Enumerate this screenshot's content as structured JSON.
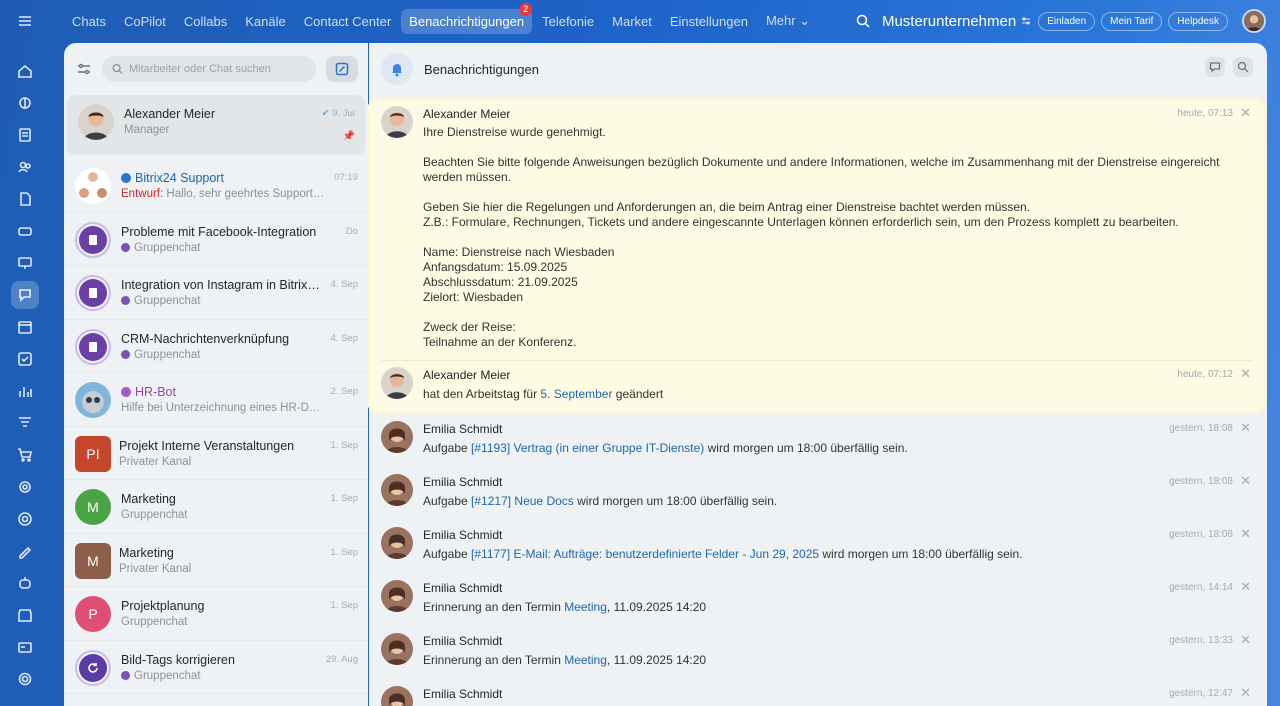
{
  "nav": {
    "items": [
      "Chats",
      "CoPilot",
      "Collabs",
      "Kanäle",
      "Contact Center",
      "Benachrichtigungen",
      "Telefonie",
      "Market",
      "Einstellungen",
      "Mehr ⌄"
    ],
    "active_badge": "2"
  },
  "top": {
    "company": "Musterunternehmen",
    "buttons": [
      "Einladen",
      "Mein Tarif",
      "Helpdesk"
    ]
  },
  "chatlist": {
    "search_placeholder": "Mitarbeiter oder Chat suchen",
    "items": [
      {
        "title": "Alexander Meier",
        "sub": "Manager",
        "date": "9. Jul"
      },
      {
        "title": "Bitrix24 Support",
        "draft": "Entwurf:",
        "sub": " Hallo, sehr geehrtes Support-T...",
        "date": "07:19"
      },
      {
        "title": "Probleme mit Facebook-Integration",
        "sub": "Gruppenchat",
        "date": "Do"
      },
      {
        "title": "Integration von Instagram in Bitrix24",
        "sub": "Gruppenchat",
        "date": "4. Sep"
      },
      {
        "title": "CRM-Nachrichtenverknüpfung",
        "sub": "Gruppenchat",
        "date": "4. Sep"
      },
      {
        "title": "HR-Bot",
        "sub": "Hilfe bei Unterzeichnung eines HR-Dok...",
        "date": "2. Sep"
      },
      {
        "title": "Projekt Interne Veranstaltungen",
        "sub": "Privater Kanal",
        "date": "1. Sep",
        "initials": "PI"
      },
      {
        "title": "Marketing",
        "sub": "Gruppenchat",
        "date": "1. Sep",
        "initials": "M"
      },
      {
        "title": "Marketing",
        "sub": "Privater Kanal",
        "date": "1. Sep",
        "initials": "M"
      },
      {
        "title": "Projektplanung",
        "sub": "Gruppenchat",
        "date": "1. Sep",
        "initials": "P"
      },
      {
        "title": "Bild-Tags korrigieren",
        "sub": "Gruppenchat",
        "date": "29. Aug"
      }
    ]
  },
  "panel": {
    "title": "Benachrichtigungen",
    "notifications": [
      {
        "author": "Alexander Meier",
        "time": "heute, 07:13",
        "lines": [
          "Ihre Dienstreise wurde genehmigt.",
          "",
          "Beachten Sie bitte folgende Anweisungen bezüglich Dokumente und andere Informationen, welche im Zusammenhang mit der Dienstreise eingereicht werden müssen.",
          "",
          "Geben Sie hier die Regelungen und Anforderungen an, die beim Antrag einer Dienstreise bachtet werden müssen.",
          "Z.B.: Formulare, Rechnungen, Tickets und andere eingescannte Unterlagen können erforderlich sein, um den Prozess komplett zu bearbeiten.",
          "",
          "Name: Dienstreise nach Wiesbaden",
          "Anfangsdatum: 15.09.2025",
          "Abschlussdatum: 21.09.2025",
          "Zielort: Wiesbaden",
          "",
          "Zweck der Reise:",
          "Teilnahme an der Konferenz."
        ]
      },
      {
        "author": "Alexander Meier",
        "time": "heute, 07:12",
        "pre": "hat den Arbeitstag für ",
        "link": "5. September",
        "post": " geändert"
      },
      {
        "author": "Emilia Schmidt",
        "time": "gestern, 18:08",
        "pre": "Aufgabe ",
        "link": "[#1193] Vertrag (in einer Gruppe IT-Dienste)",
        "post": " wird morgen um 18:00 überfällig sein."
      },
      {
        "author": "Emilia Schmidt",
        "time": "gestern, 18:08",
        "pre": "Aufgabe ",
        "link": "[#1217] Neue Docs",
        "post": " wird morgen um 18:00 überfällig sein."
      },
      {
        "author": "Emilia Schmidt",
        "time": "gestern, 18:08",
        "pre": "Aufgabe ",
        "link": "[#1177] E-Mail: Aufträge: benutzerdefinierte Felder - Jun 29, 2025",
        "post": " wird morgen um 18:00 überfällig sein."
      },
      {
        "author": "Emilia Schmidt",
        "time": "gestern, 14:14",
        "pre": "Erinnerung an den Termin ",
        "link": "Meeting",
        "post": ", 11.09.2025 14:20"
      },
      {
        "author": "Emilia Schmidt",
        "time": "gestern, 13:33",
        "pre": "Erinnerung an den Termin ",
        "link": "Meeting",
        "post": ", 11.09.2025 14:20"
      },
      {
        "author": "Emilia Schmidt",
        "time": "gestern, 12:47"
      }
    ]
  },
  "colors": {
    "accent": "#2066b0",
    "highlight_bg": "#fdfbe3",
    "draft": "#d0262b",
    "badge": "#e6383e"
  }
}
